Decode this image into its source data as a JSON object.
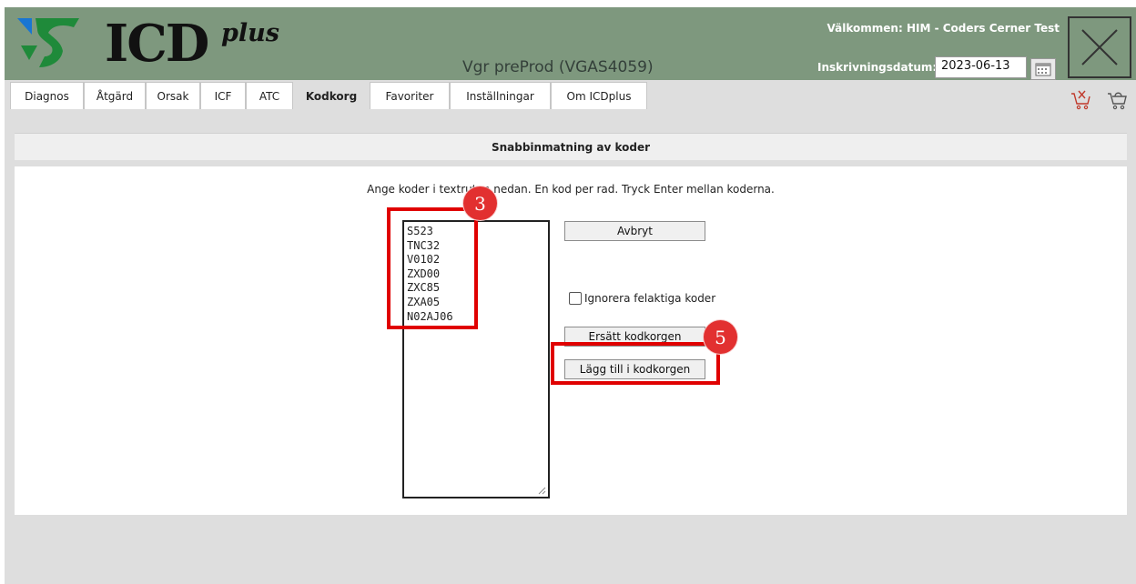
{
  "app": {
    "logo_text": "ICD",
    "logo_plus": "plus",
    "environment": "Vgr preProd (VGAS4059)",
    "welcome": "Välkommen: HIM - Coders Cerner Test",
    "date_label": "Inskrivningsdatum:",
    "date_value": "2023-06-13"
  },
  "tabs": [
    {
      "label": "Diagnos",
      "active": false
    },
    {
      "label": "Åtgärd",
      "active": false
    },
    {
      "label": "Orsak",
      "active": false
    },
    {
      "label": "ICF",
      "active": false
    },
    {
      "label": "ATC",
      "active": false
    },
    {
      "label": "Kodkorg",
      "active": true
    },
    {
      "label": "Favoriter",
      "active": false
    },
    {
      "label": "Inställningar",
      "active": false
    },
    {
      "label": "Om ICDplus",
      "active": false
    }
  ],
  "section": {
    "title": "Snabbinmatning av koder",
    "instructions": "Ange koder i textrutan nedan. En kod per rad. Tryck Enter mellan koderna."
  },
  "codes": [
    "S523",
    "TNC32",
    "V0102",
    "ZXD00",
    "ZXC85",
    "ZXA05",
    "N02AJ06"
  ],
  "buttons": {
    "cancel": "Avbryt",
    "replace": "Ersätt kodkorgen",
    "add": "Lägg till i kodkorgen"
  },
  "ignore_label": "Ignorera felaktiga koder",
  "annotations": {
    "step_codes": "3",
    "step_add": "5",
    "highlight_color": "#e00000"
  },
  "colors": {
    "header": "#7e987e",
    "background": "#dedede"
  }
}
